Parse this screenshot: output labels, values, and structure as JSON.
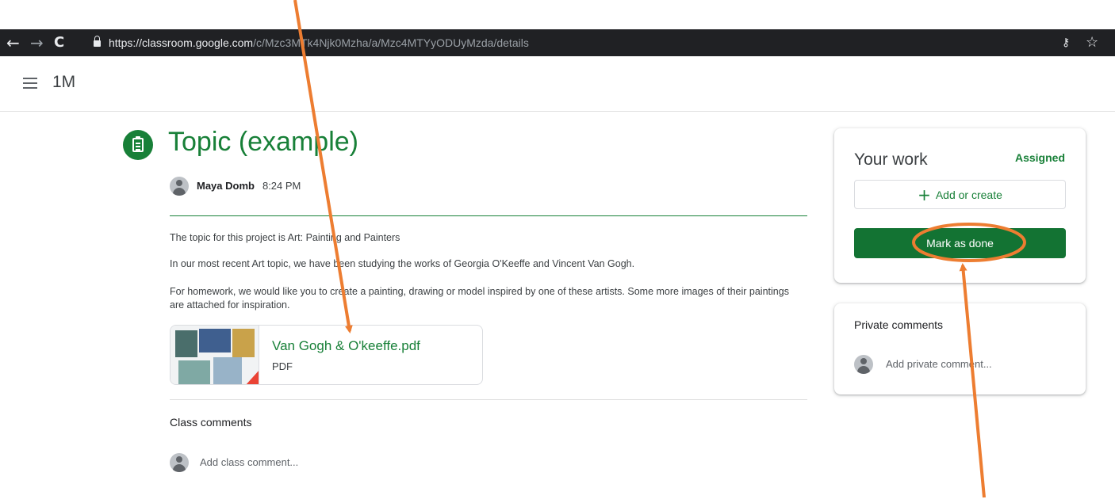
{
  "browser": {
    "back_icon": "arrow-left-icon",
    "forward_icon": "arrow-right-icon",
    "reload_icon": "reload-icon",
    "url_host": "https://classroom.google.com",
    "url_path": "/c/Mzc3MTk4Njk0Mzha/a/Mzc4MTYyODUyMzda/details",
    "key_icon": "key-icon",
    "star_icon": "star-icon"
  },
  "header": {
    "menu_icon": "hamburger-menu-icon",
    "class_name": "1M"
  },
  "assignment": {
    "icon": "assignment-icon",
    "title": "Topic (example)",
    "author": "Maya Domb",
    "time": "8:24 PM",
    "paragraphs": [
      "The topic for this project is Art: Painting and Painters",
      "In our most recent Art topic, we have been studying the works of Georgia O'Keeffe and Vincent Van Gogh.",
      "For homework, we would like you to create a painting, drawing or model inspired by one of these artists. Some more images of their paintings are attached for inspiration."
    ],
    "attachment": {
      "title": "Van Gogh & O'keeffe.pdf",
      "type": "PDF"
    }
  },
  "class_comments": {
    "title": "Class comments",
    "placeholder": "Add class comment..."
  },
  "your_work": {
    "title": "Your work",
    "status": "Assigned",
    "add_label": "Add or create",
    "done_label": "Mark as done"
  },
  "private_comments": {
    "title": "Private comments",
    "placeholder": "Add private comment..."
  },
  "colors": {
    "brand_green": "#188038",
    "button_green": "#137333",
    "annotation_orange": "#ed7d31",
    "browser_bar": "#202124"
  }
}
